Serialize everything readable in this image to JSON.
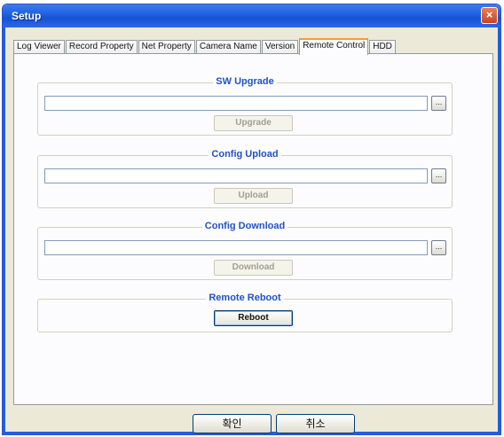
{
  "window": {
    "title": "Setup",
    "close_glyph": "×"
  },
  "tabs": [
    {
      "label": "Log Viewer",
      "active": false
    },
    {
      "label": "Record Property",
      "active": false
    },
    {
      "label": "Net Property",
      "active": false
    },
    {
      "label": "Camera Name",
      "active": false
    },
    {
      "label": "Version",
      "active": false
    },
    {
      "label": "Remote Control",
      "active": true
    },
    {
      "label": "HDD",
      "active": false
    }
  ],
  "sections": {
    "sw_upgrade": {
      "title": "SW Upgrade",
      "path_value": "",
      "browse_label": "...",
      "button_label": "Upgrade",
      "button_enabled": false
    },
    "config_upload": {
      "title": "Config Upload",
      "path_value": "",
      "browse_label": "...",
      "button_label": "Upload",
      "button_enabled": false
    },
    "config_download": {
      "title": "Config Download",
      "path_value": "",
      "browse_label": "...",
      "button_label": "Download",
      "button_enabled": false
    },
    "remote_reboot": {
      "title": "Remote Reboot",
      "button_label": "Reboot",
      "button_enabled": true
    }
  },
  "footer": {
    "ok_label": "확인",
    "cancel_label": "취소"
  },
  "colors": {
    "title_bar": "#1f5fe0",
    "group_title": "#2151c6",
    "dialog_bg": "#ece9d8",
    "active_tab_accent": "#f0a030"
  }
}
